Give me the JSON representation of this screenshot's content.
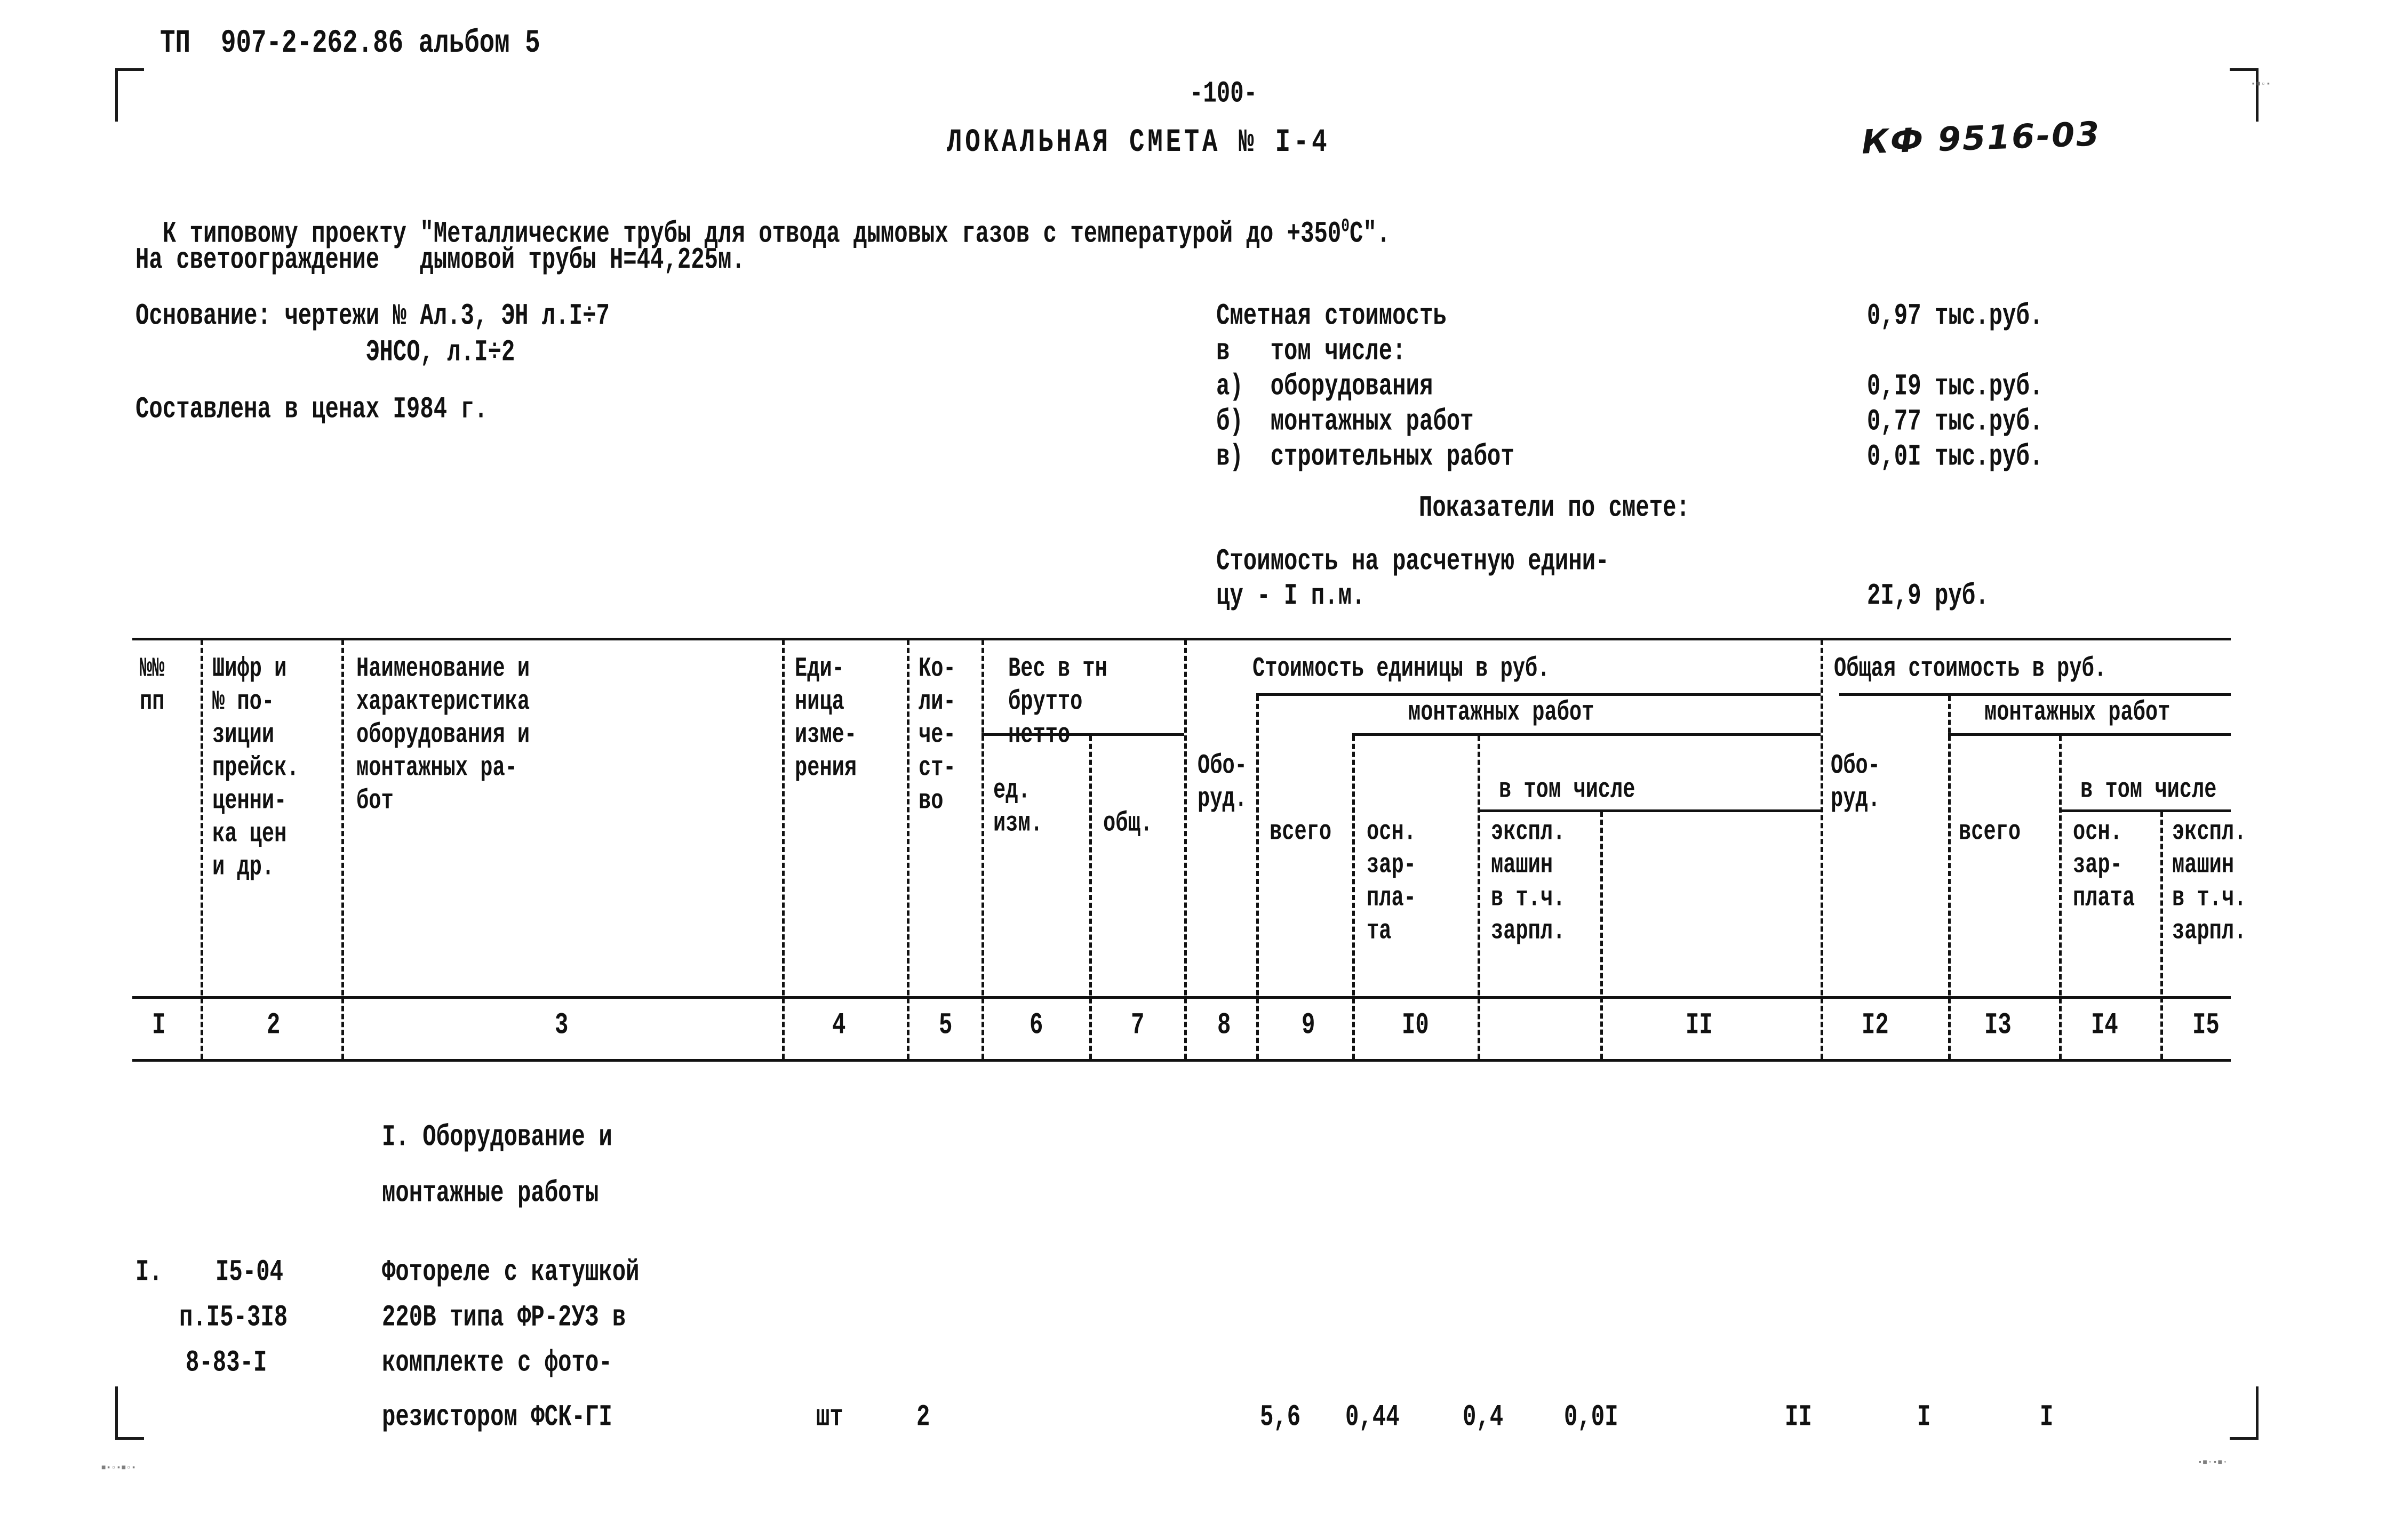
{
  "document": {
    "project_code": "ТП  907-2-262.86 альбом 5",
    "page_number": "-100-",
    "title": "ЛОКАЛЬНАЯ СМЕТА № I-4",
    "archive_code": "КФ 9516-03",
    "intro_line": "К типовому проекту \"Металлические трубы для отвода дымовых газов с температурой до +350",
    "intro_sup": "0",
    "intro_tail": "С\".",
    "subject_line": "На светоограждение   дымовой трубы Н=44,225м.",
    "basis_line1": "Основание: чертежи № Ал.3, ЭН л.I÷7",
    "basis_line2": "ЭНСО, л.I÷2",
    "prices_line": "Составлена в ценах I984 г."
  },
  "summary": {
    "total_label": "Сметная стоимость",
    "total_value": "0,97 тыс.руб.",
    "including_label": "в   том числе:",
    "rows": [
      {
        "label": "а)  оборудования",
        "value": "0,I9 тыс.руб."
      },
      {
        "label": "б)  монтажных работ",
        "value": "0,77 тыс.руб."
      },
      {
        "label": "в)  строительных работ",
        "value": "0,0I тыс.руб."
      }
    ],
    "indicators_label": "Показатели по смете:",
    "unit_cost_line1": "Стоимость на расчетную едини-",
    "unit_cost_line2": "цу - I п.м.",
    "unit_cost_value": "2I,9 руб."
  },
  "table": {
    "group_headers": {
      "unit_cost": "Стоимость единицы в руб.",
      "total_cost": "Общая стоимость в руб.",
      "install_works_left": "монтажных работ",
      "install_works_right": "монтажных работ",
      "in_which_left": "в том числе",
      "in_which_right": "в том числе",
      "weight": "Вес в тн",
      "weight_gross": "брутто",
      "weight_net": "нетто"
    },
    "headers": [
      {
        "key": "no",
        "lines": [
          "№№",
          "пп"
        ]
      },
      {
        "key": "code",
        "lines": [
          "Шифр и",
          "№ по-",
          "зиции",
          "прейск.",
          "ценни-",
          "ка цен",
          "и др."
        ]
      },
      {
        "key": "name",
        "lines": [
          "Наименование и",
          "характеристика",
          "оборудования и",
          "монтажных ра-",
          "бот"
        ]
      },
      {
        "key": "unit",
        "lines": [
          "Еди-",
          "ница",
          "изме-",
          "рения"
        ]
      },
      {
        "key": "qty",
        "lines": [
          "Ко-",
          "ли-",
          "че-",
          "ст-",
          "во"
        ]
      },
      {
        "key": "w_unit",
        "lines": [
          "ед.",
          "изм."
        ]
      },
      {
        "key": "w_total",
        "lines": [
          "общ."
        ]
      },
      {
        "key": "equip_u",
        "lines": [
          "Обо-",
          "руд."
        ]
      },
      {
        "key": "inst_all_u",
        "lines": [
          "всего"
        ]
      },
      {
        "key": "salary_u",
        "lines": [
          "осн.",
          "зар-",
          "пла-",
          "та"
        ]
      },
      {
        "key": "machine_u",
        "lines": [
          "экспл.",
          "машин",
          "в т.ч.",
          "зарпл."
        ]
      },
      {
        "key": "equip_t",
        "lines": [
          "Обо-",
          "руд."
        ]
      },
      {
        "key": "inst_all_t",
        "lines": [
          "всего"
        ]
      },
      {
        "key": "salary_t",
        "lines": [
          "осн.",
          "зар-",
          "плата"
        ]
      },
      {
        "key": "machine_t",
        "lines": [
          "экспл.",
          "машин",
          "в т.ч.",
          "зарпл."
        ]
      }
    ],
    "column_numbers": [
      "I",
      "2",
      "3",
      "4",
      "5",
      "6",
      "7",
      "8",
      "9",
      "I0",
      "II",
      "I2",
      "I3",
      "I4",
      "I5"
    ],
    "section_title_lines": [
      "I. Оборудование и",
      "монтажные работы"
    ],
    "rows": [
      {
        "no": "I.",
        "code_lines": [
          "I5-04",
          "п.I5-3I8",
          "8-83-I"
        ],
        "name_lines": [
          "Фотореле с катушкой",
          "220В типа ФР-2УЗ в",
          "комплекте с фото-",
          "резистором ФСК-ГI"
        ],
        "unit": "шт",
        "qty": "2",
        "w_unit": "",
        "w_total": "",
        "equip_u": "5,6",
        "inst_all_u": "0,44",
        "salary_u": "0,4",
        "machine_u": "0,0I",
        "equip_t": "II",
        "inst_all_t": "I",
        "salary_t": "I",
        "machine_t": ""
      }
    ]
  }
}
